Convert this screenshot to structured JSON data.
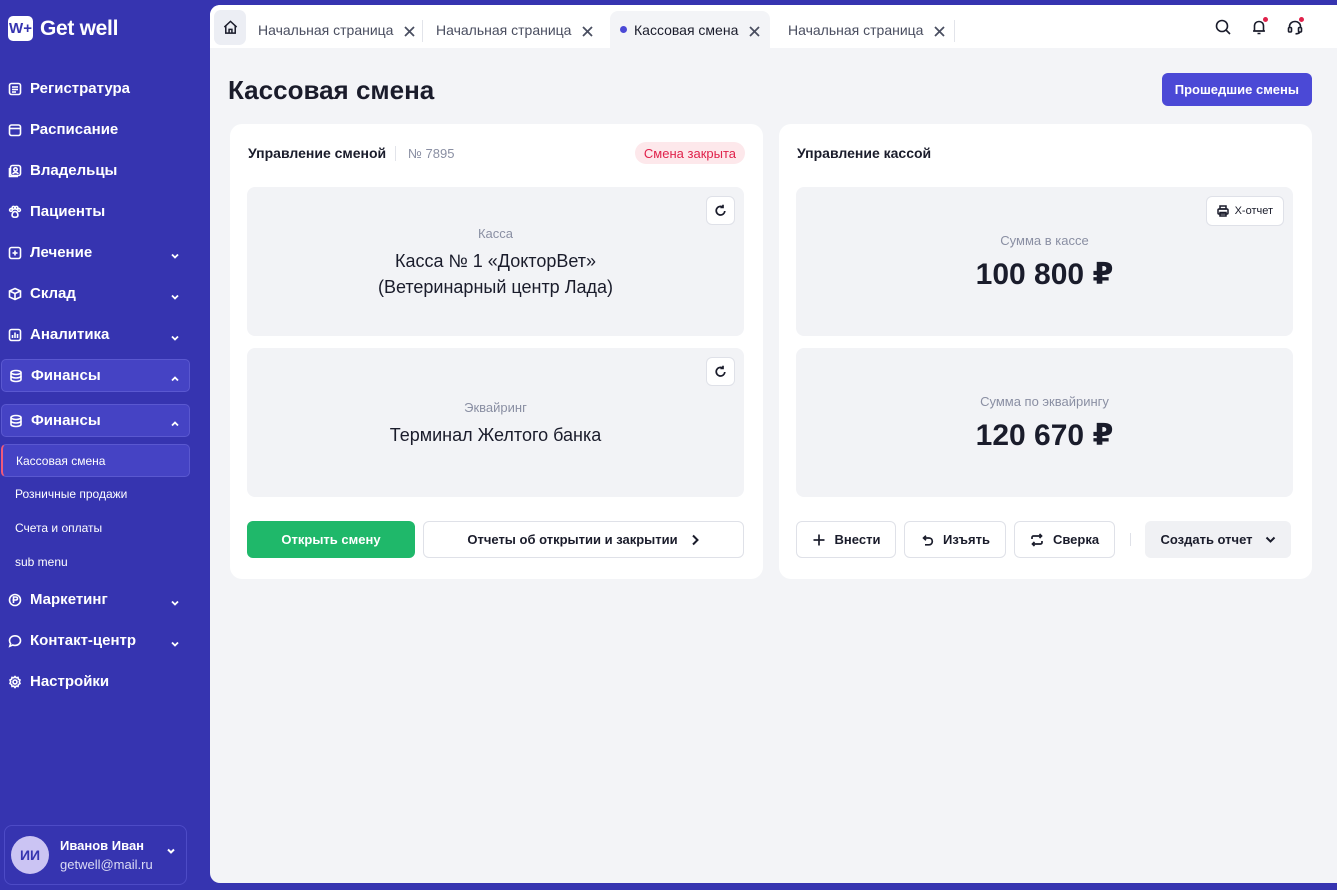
{
  "app": {
    "logo_mark": "W+",
    "name": "Get well"
  },
  "sidebar": {
    "items": [
      {
        "label": "Регистратура",
        "icon": "register-icon"
      },
      {
        "label": "Расписание",
        "icon": "calendar-icon"
      },
      {
        "label": "Владельцы",
        "icon": "owners-icon"
      },
      {
        "label": "Пациенты",
        "icon": "paw-icon"
      },
      {
        "label": "Лечение",
        "icon": "plus-square-icon"
      },
      {
        "label": "Склад",
        "icon": "box-icon"
      },
      {
        "label": "Аналитика",
        "icon": "analytics-icon"
      },
      {
        "label": "Финансы",
        "icon": "database-icon"
      },
      {
        "label": "Финансы",
        "icon": "database-icon"
      },
      {
        "label": "Маркетинг",
        "icon": "ruble-circle-icon"
      },
      {
        "label": "Контакт-центр",
        "icon": "chat-icon"
      },
      {
        "label": "Настройки",
        "icon": "gear-icon"
      }
    ],
    "finance_sub": [
      "Кассовая смена",
      "Розничные продажи",
      "Счета и оплаты",
      "sub menu"
    ]
  },
  "user": {
    "initials": "ИИ",
    "name": "Иванов Иван",
    "email": "getwell@mail.ru"
  },
  "tabs": [
    {
      "label": "Начальная страница",
      "active": false
    },
    {
      "label": "Начальная страница",
      "active": false
    },
    {
      "label": "Кассовая смена",
      "active": true
    },
    {
      "label": "Начальная страница",
      "active": false
    }
  ],
  "page": {
    "title": "Кассовая смена",
    "past_shifts_button": "Прошедшие смены"
  },
  "shift_card": {
    "title": "Управление сменой",
    "number": "№ 7895",
    "status": "Смена закрыта",
    "register_label": "Касса",
    "register_line1": "Касса № 1 «ДокторВет»",
    "register_line2": "(Ветеринарный центр Лада)",
    "acquiring_label": "Эквайринг",
    "acquiring_value": "Терминал Желтого банка",
    "open_button": "Открыть смену",
    "reports_button": "Отчеты об открытии и закрытии"
  },
  "cash_card": {
    "title": "Управление кассой",
    "xreport_button": "X-отчет",
    "cash_label": "Сумма в кассе",
    "cash_value": "100 800 ₽",
    "acquiring_label": "Сумма по эквайрингу",
    "acquiring_value": "120 670 ₽",
    "deposit_button": "Внести",
    "withdraw_button": "Изъять",
    "reconcile_button": "Сверка",
    "create_report_button": "Создать отчет"
  },
  "colors": {
    "sidebar_bg": "#3634b0",
    "accent": "#4b49d6",
    "success": "#1fb86a",
    "danger": "#e0224b"
  }
}
